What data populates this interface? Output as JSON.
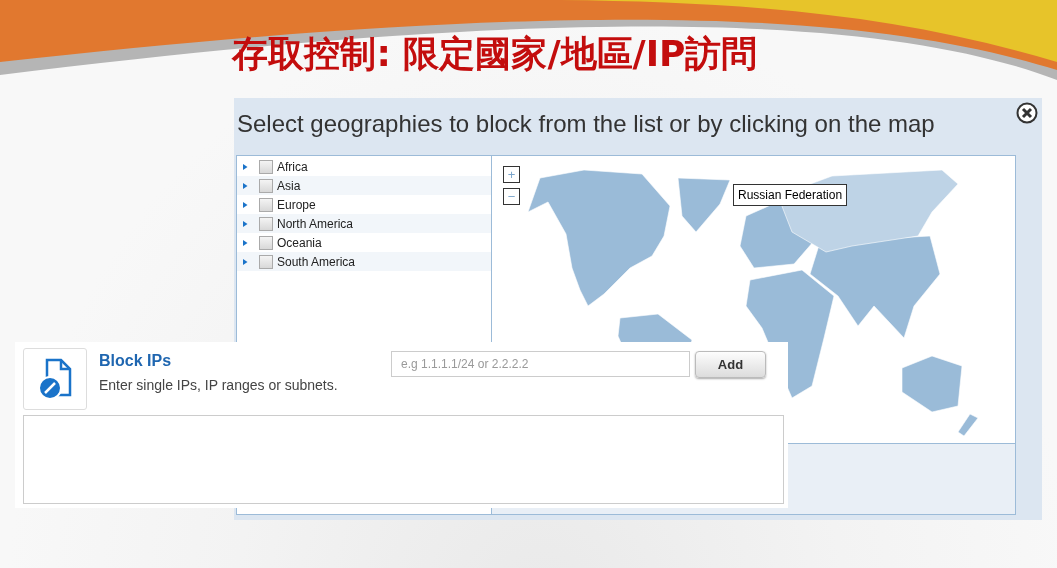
{
  "slide_title": "存取控制: 限定國家/地區/IP訪問",
  "geo_dialog": {
    "title": "Select geographies to block from the list or by clicking on the map",
    "regions": [
      {
        "label": "Africa",
        "checked": false,
        "expanded": false
      },
      {
        "label": "Asia",
        "checked": false,
        "expanded": false
      },
      {
        "label": "Europe",
        "checked": false,
        "expanded": false
      },
      {
        "label": "North America",
        "checked": false,
        "expanded": false
      },
      {
        "label": "Oceania",
        "checked": false,
        "expanded": false
      },
      {
        "label": "South America",
        "checked": false,
        "expanded": false
      }
    ],
    "map": {
      "zoom_in": "+",
      "zoom_out": "−",
      "tooltip": "Russian Federation"
    }
  },
  "block_ips": {
    "title": "Block IPs",
    "description": "Enter single IPs, IP ranges or subnets.",
    "placeholder": "e.g 1.1.1.1/24 or 2.2.2.2",
    "button": "Add"
  }
}
